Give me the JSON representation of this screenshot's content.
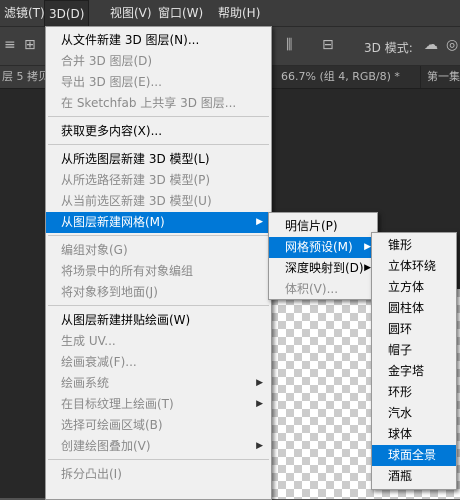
{
  "menubar": {
    "filter": "滤镜(T)",
    "three_d": "3D(D)",
    "view": "视图(V)",
    "window": "窗口(W)",
    "help": "帮助(H)"
  },
  "optbar": {
    "mode_label": "3D 模式:"
  },
  "tabs": {
    "left": "层 5 拷贝",
    "mid": "66.7% (组 4, RGB/8) *",
    "right": "第一集"
  },
  "menu_3d": {
    "items": [
      {
        "label": "从文件新建 3D 图层(N)...",
        "disabled": false
      },
      {
        "label": "合并 3D 图层(D)",
        "disabled": true
      },
      {
        "label": "导出 3D 图层(E)...",
        "disabled": true
      },
      {
        "label": "在 Sketchfab 上共享 3D 图层...",
        "disabled": true
      },
      {
        "label": "获取更多内容(X)...",
        "disabled": false
      },
      {
        "label": "从所选图层新建 3D 模型(L)",
        "disabled": false
      },
      {
        "label": "从所选路径新建 3D 模型(P)",
        "disabled": true
      },
      {
        "label": "从当前选区新建 3D 模型(U)",
        "disabled": true
      },
      {
        "label": "从图层新建网格(M)",
        "disabled": false
      },
      {
        "label": "编组对象(G)",
        "disabled": true
      },
      {
        "label": "将场景中的所有对象编组",
        "disabled": true
      },
      {
        "label": "将对象移到地面(J)",
        "disabled": true
      },
      {
        "label": "从图层新建拼贴绘画(W)",
        "disabled": false
      },
      {
        "label": "生成 UV...",
        "disabled": true
      },
      {
        "label": "绘画衰减(F)...",
        "disabled": true
      },
      {
        "label": "绘画系统",
        "disabled": true
      },
      {
        "label": "在目标纹理上绘画(T)",
        "disabled": true
      },
      {
        "label": "选择可绘画区域(B)",
        "disabled": true
      },
      {
        "label": "创建绘图叠加(V)",
        "disabled": true
      },
      {
        "label": "拆分凸出(I)",
        "disabled": true
      }
    ]
  },
  "submenu_mesh": {
    "items": [
      {
        "label": "明信片(P)",
        "disabled": false
      },
      {
        "label": "网格预设(M)",
        "disabled": false
      },
      {
        "label": "深度映射到(D)",
        "disabled": false
      },
      {
        "label": "体积(V)...",
        "disabled": true
      }
    ]
  },
  "submenu_presets": {
    "items": [
      "锥形",
      "立体环绕",
      "立方体",
      "圆柱体",
      "圆环",
      "帽子",
      "金字塔",
      "环形",
      "汽水",
      "球体",
      "球面全景",
      "酒瓶"
    ]
  },
  "colors": {
    "highlight": "#0078d7",
    "menu_bg": "#f0f0f0"
  }
}
